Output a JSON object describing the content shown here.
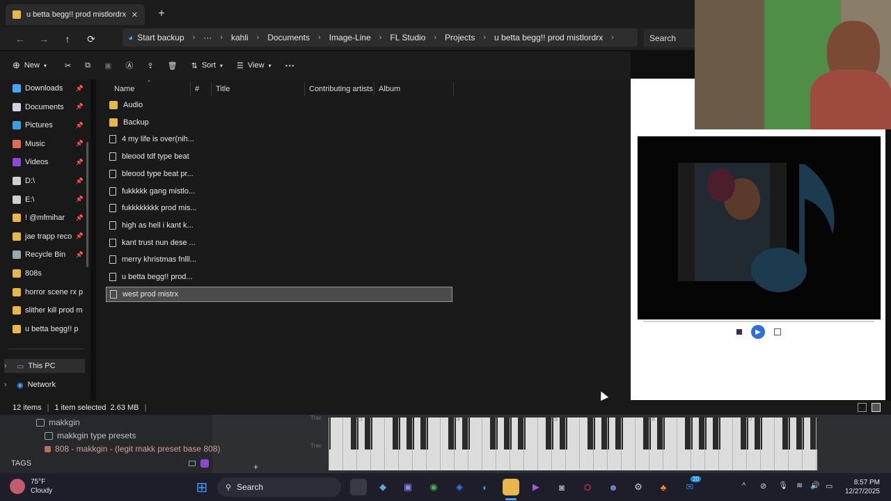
{
  "window": {
    "tab_title": "u betta begg!! prod mistlordrx",
    "new_tab_symbol": "+",
    "tab_close_symbol": "✕"
  },
  "address": {
    "backup_label": "Start backup",
    "more_crumbs": "···",
    "crumbs": [
      "kahli",
      "Documents",
      "Image-Line",
      "FL Studio",
      "Projects",
      "u betta begg!! prod mistlordrx"
    ],
    "search_placeholder": "Search"
  },
  "toolbar": {
    "new_label": "New",
    "sort_label": "Sort",
    "view_label": "View",
    "more_label": "···"
  },
  "sidebar": {
    "items": [
      {
        "label": "Downloads",
        "icon": "download-icon",
        "pinned": true
      },
      {
        "label": "Documents",
        "icon": "document-icon",
        "pinned": true
      },
      {
        "label": "Pictures",
        "icon": "pictures-icon",
        "pinned": true
      },
      {
        "label": "Music",
        "icon": "music-icon",
        "pinned": true
      },
      {
        "label": "Videos",
        "icon": "videos-icon",
        "pinned": true
      },
      {
        "label": "D:\\",
        "icon": "drive-icon",
        "pinned": true
      },
      {
        "label": "E:\\",
        "icon": "drive-icon",
        "pinned": true
      },
      {
        "label": "!  @mfmihar",
        "icon": "folder-icon",
        "pinned": true
      },
      {
        "label": "jae trapp reco",
        "icon": "folder-icon",
        "pinned": true
      },
      {
        "label": "Recycle Bin",
        "icon": "recycle-bin-icon",
        "pinned": true
      },
      {
        "label": "808s",
        "icon": "folder-icon",
        "pinned": false
      },
      {
        "label": "horror scene rx p",
        "icon": "folder-icon",
        "pinned": false
      },
      {
        "label": "slither kill prod m",
        "icon": "folder-icon",
        "pinned": false
      },
      {
        "label": "u betta begg!! p",
        "icon": "folder-icon",
        "pinned": false
      }
    ],
    "this_pc": "This PC",
    "network": "Network"
  },
  "columns": [
    "Name",
    "#",
    "Title",
    "Contributing artists",
    "Album"
  ],
  "files": [
    {
      "name": "Audio",
      "type": "folder"
    },
    {
      "name": "Backup",
      "type": "folder"
    },
    {
      "name": "4 my life is over(nih...",
      "type": "file"
    },
    {
      "name": "bleood tdf type beat",
      "type": "file"
    },
    {
      "name": "bleood type beat pr...",
      "type": "file"
    },
    {
      "name": "fukkkkk gang mistlo...",
      "type": "file"
    },
    {
      "name": "fukkkkkkkk prod mis...",
      "type": "file"
    },
    {
      "name": "high as hell i kant k...",
      "type": "file"
    },
    {
      "name": "kant trust nun dese ...",
      "type": "file"
    },
    {
      "name": "merry khristmas fnlll...",
      "type": "file"
    },
    {
      "name": "u betta begg!! prod...",
      "type": "file"
    },
    {
      "name": "west prod mistrx",
      "type": "file",
      "selected": true
    }
  ],
  "status": {
    "count": "12 items",
    "selection": "1 item selected  2.63 MB"
  },
  "fl_studio": {
    "browser_items": [
      "makkgin",
      "makkgin type presets",
      "808 - makkgin - (legit makk preset base 808)"
    ],
    "tags_label": "TAGS",
    "plus_symbol": "+",
    "octave_labels": [
      "C3",
      "C4",
      "C5",
      "C6",
      "C7"
    ],
    "track_labels": [
      "Trac",
      "Trac"
    ]
  },
  "weather": {
    "temp": "75°F",
    "condition": "Cloudy"
  },
  "taskbar": {
    "search_label": "Search",
    "time": "8:57 PM",
    "date": "12/27/2025",
    "notification_count": "20"
  },
  "colors": {
    "accent": "#4aa3ff",
    "folder": "#e8b64a",
    "selected_row": "#4b4b4b"
  }
}
